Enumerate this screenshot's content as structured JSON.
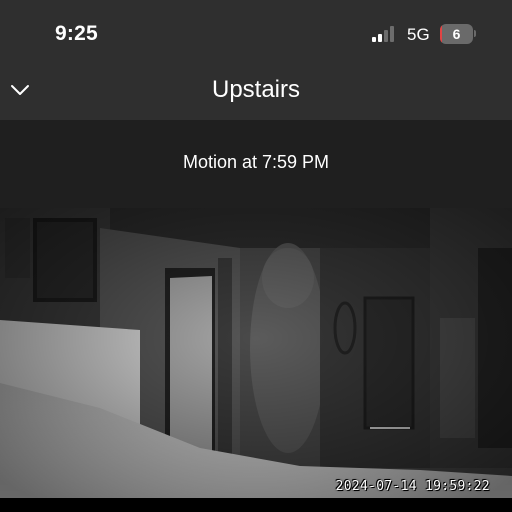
{
  "status_bar": {
    "time": "9:25",
    "network": "5G",
    "battery_level": "6",
    "battery_color": "#e24444",
    "icons": [
      "signal-bars-icon",
      "battery-icon"
    ]
  },
  "nav": {
    "title": "Upstairs",
    "back_icon": "chevron-down-icon"
  },
  "event": {
    "label": "Motion at 7:59 PM"
  },
  "video": {
    "timestamp": "2024-07-14 19:59:22"
  },
  "colors": {
    "bar_background": "#2f2f2f",
    "event_background": "#1f1f1f"
  }
}
